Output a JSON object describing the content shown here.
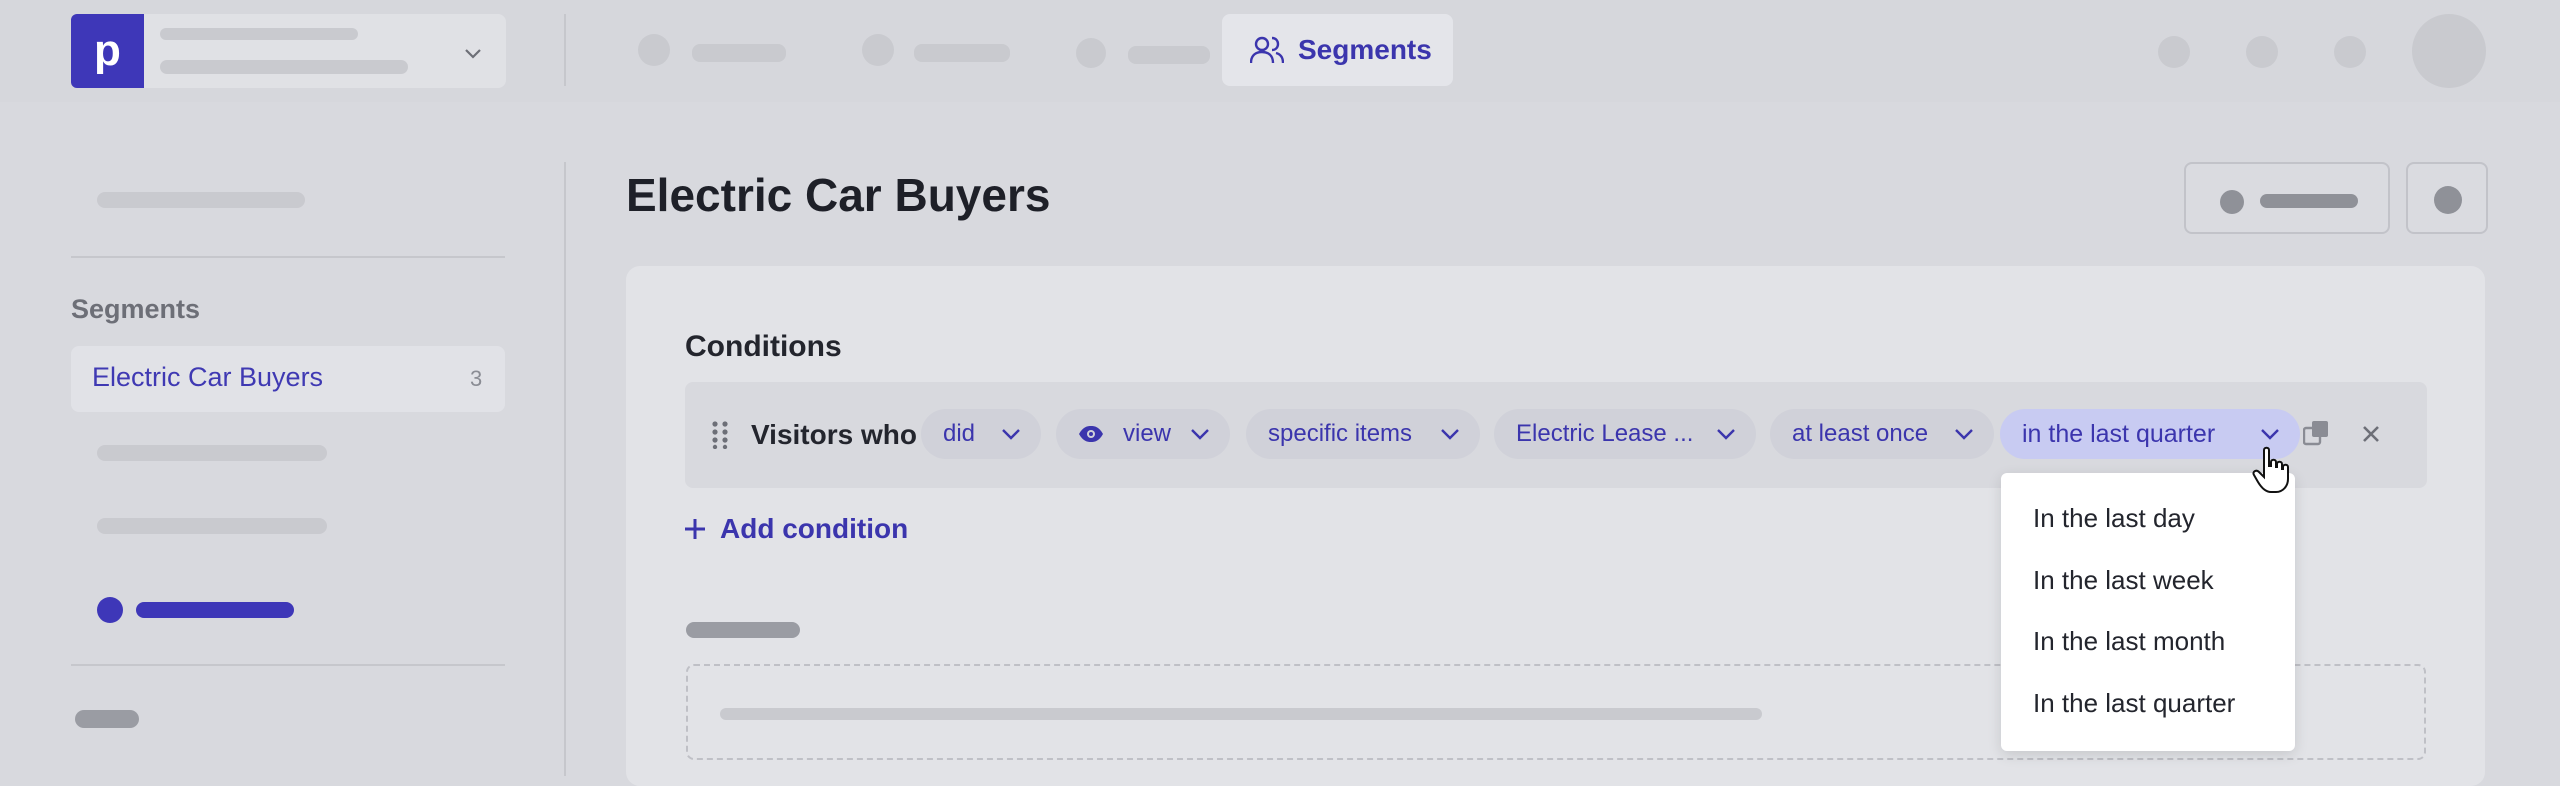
{
  "top_nav": {
    "active_tab_label": "Segments",
    "logo_letter": "p"
  },
  "sidebar": {
    "section_label": "Segments",
    "items": [
      {
        "label": "Electric Car Buyers",
        "count": "3"
      }
    ]
  },
  "page": {
    "title": "Electric Car Buyers"
  },
  "conditions": {
    "heading": "Conditions",
    "row": {
      "prefix": "Visitors who",
      "pills": {
        "action": "did",
        "event": "view",
        "target": "specific items",
        "item": "Electric Lease ...",
        "frequency": "at least once",
        "timeframe": "in the last quarter"
      }
    },
    "add_label": "Add condition"
  },
  "timeframe_dropdown": {
    "options": [
      "In the last day",
      "In the last week",
      "In the last month",
      "In the last quarter"
    ]
  },
  "colors": {
    "accent": "#3e37b8",
    "background": "#d8d9de"
  }
}
